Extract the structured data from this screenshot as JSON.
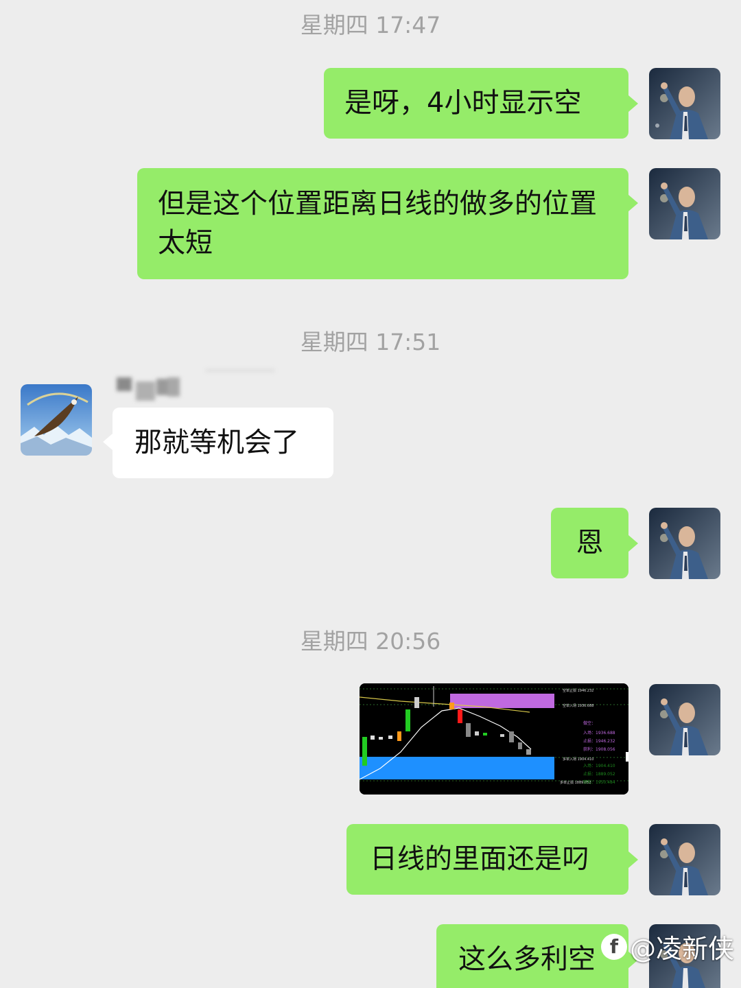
{
  "timestamps": [
    "星期四 17:47",
    "星期四 17:51",
    "星期四 20:56"
  ],
  "messages": [
    {
      "from": "me",
      "text": "是呀，4小时显示空"
    },
    {
      "from": "me",
      "text": "但是这个位置距离日线的做多的位置太短"
    },
    {
      "from": "them",
      "text": "那就等机会了"
    },
    {
      "from": "me",
      "text": "恩"
    },
    {
      "from": "me",
      "type": "image",
      "content": "chart-screenshot"
    },
    {
      "from": "me",
      "text": "日线的里面还是叼"
    },
    {
      "from": "me",
      "text": "这么多利空"
    }
  ],
  "chart_image": {
    "right_labels": [
      "空单止损 1946.232",
      "空单入场 1936.688",
      "多单入场 1904.410",
      "多单止损 1889.052"
    ],
    "signal_labels": [
      "做空：",
      "入场：1936.688",
      "止损：1946.232",
      "获利：1908.056",
      "入场：1904.410",
      "止损：1889.052",
      "获利：1950.484"
    ]
  },
  "watermark": {
    "logo": "f",
    "text": "@凌新侠"
  },
  "colors": {
    "background": "#ededed",
    "my_bubble": "#95ec69",
    "their_bubble": "#ffffff",
    "timestamp": "#a2a2a2"
  }
}
